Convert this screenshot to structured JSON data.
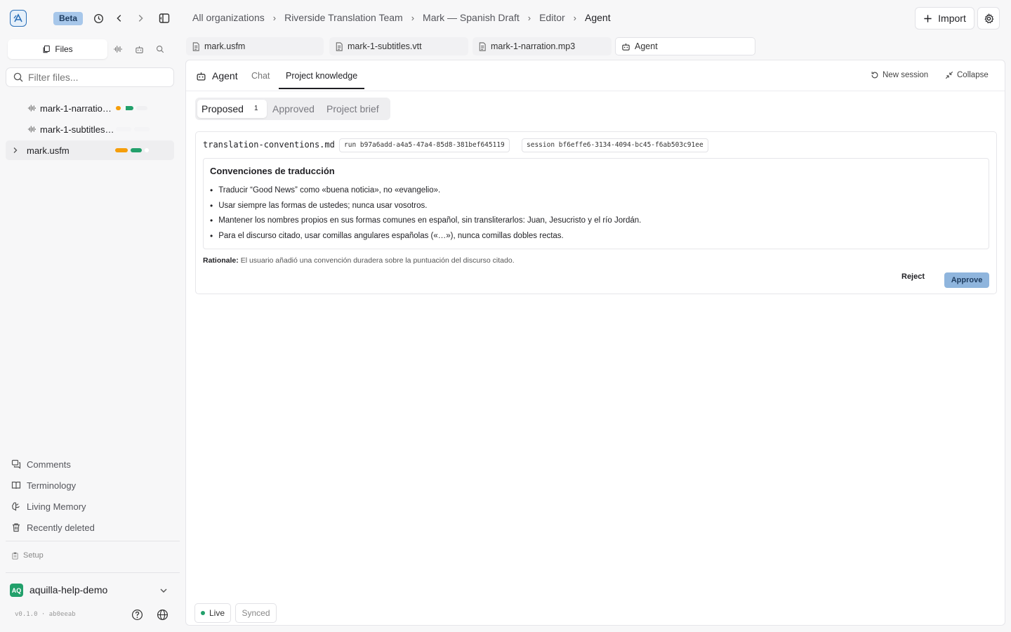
{
  "header": {
    "beta_label": "Beta",
    "breadcrumb": [
      "All organizations",
      "Riverside Translation Team",
      "Mark — Spanish Draft",
      "Editor",
      "Agent"
    ],
    "import_label": "Import"
  },
  "sidebar": {
    "files_tab_label": "Files",
    "filter_placeholder": "Filter files...",
    "files": [
      {
        "name": "mark-1-narratio…",
        "icon": "audio-waveform-icon"
      },
      {
        "name": "mark-1-subtitles…",
        "icon": "audio-waveform-icon"
      },
      {
        "name": "mark.usfm",
        "icon": "chevron-right-icon"
      }
    ],
    "links": [
      {
        "label": "Comments",
        "icon": "comments-icon"
      },
      {
        "label": "Terminology",
        "icon": "book-icon"
      },
      {
        "label": "Living Memory",
        "icon": "brain-icon"
      },
      {
        "label": "Recently deleted",
        "icon": "trash-icon"
      }
    ],
    "setup_label": "Setup",
    "org": {
      "badge": "AQ",
      "name": "aquilla-help-demo"
    },
    "version": "v0.1.0 · ab0eeab"
  },
  "doc_tabs": [
    {
      "label": "mark.usfm"
    },
    {
      "label": "mark-1-subtitles.vtt"
    },
    {
      "label": "mark-1-narration.mp3"
    },
    {
      "label": "Agent"
    }
  ],
  "panel": {
    "title": "Agent",
    "tabs": [
      "Chat",
      "Project knowledge"
    ],
    "active_tab": "Project knowledge",
    "new_session_label": "New session",
    "collapse_label": "Collapse",
    "segments": {
      "proposed": "Proposed",
      "proposed_count": "1",
      "approved": "Approved",
      "brief": "Project brief"
    },
    "proposal": {
      "filename": "translation-conventions.md",
      "run": "run b97a6add-a4a5-47a4-85d8-381bef645119",
      "session": "session bf6effe6-3134-4094-bc45-f6ab503c91ee",
      "title": "Convenciones de traducción",
      "items": [
        "Traducir “Good News” como «buena noticia», no «evangelio».",
        "Usar siempre las formas de ustedes; nunca usar vosotros.",
        "Mantener los nombres propios en sus formas comunes en español, sin transliterarlos: Juan, Jesucristo y el río Jordán.",
        "Para el discurso citado, usar comillas angulares españolas («…»), nunca comillas dobles rectas."
      ],
      "rationale_label": "Rationale:",
      "rationale_text": "El usuario añadió una convención duradera sobre la puntuación del discurso citado.",
      "reject_label": "Reject",
      "approve_label": "Approve"
    },
    "status": {
      "live": "Live",
      "synced": "Synced"
    }
  },
  "colors": {
    "accent": "#8fb5dd",
    "live_dot": "#22a06b",
    "bar_orange": "#f59e0b",
    "bar_green": "#22a06b"
  }
}
